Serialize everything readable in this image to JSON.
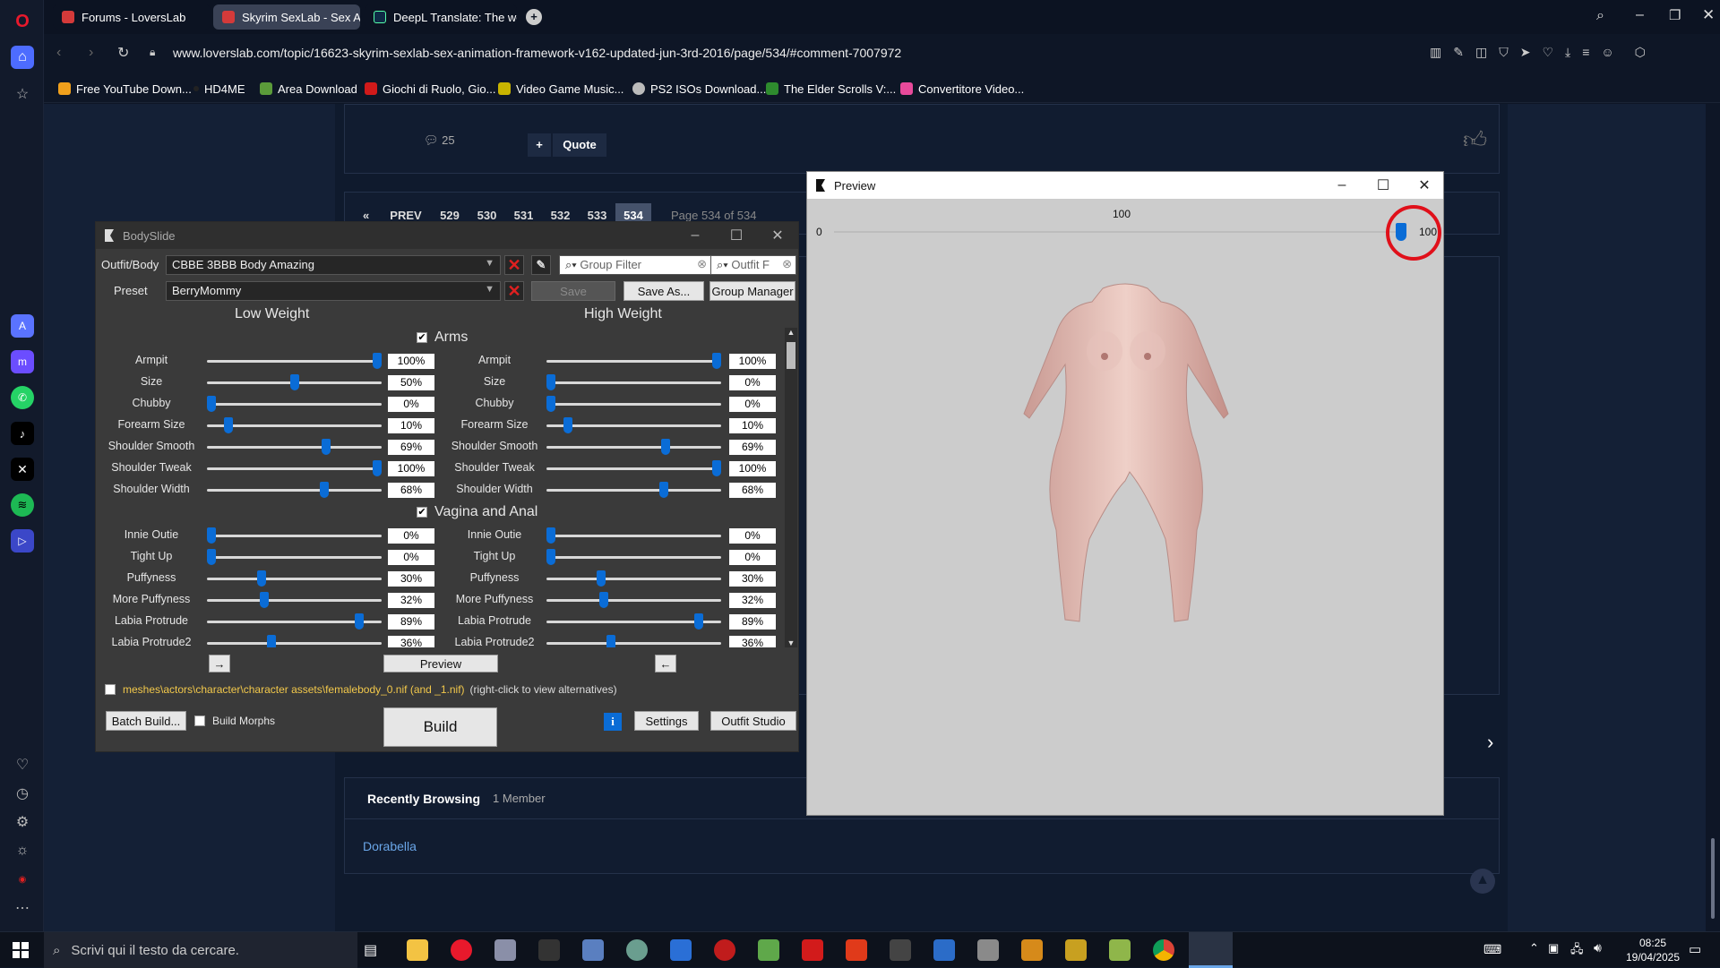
{
  "browser": {
    "tabs": [
      {
        "title": "Forums - LoversLab",
        "active": false
      },
      {
        "title": "Skyrim SexLab - Sex Anim",
        "active": true
      },
      {
        "title": "DeepL Translate: The worl",
        "active": false
      }
    ],
    "url": "www.loverslab.com/topic/16623-skyrim-sexlab-sex-animation-framework-v162-updated-jun-3rd-2016/page/534/#comment-7007972",
    "bookmarks": [
      "Free YouTube Down...",
      "HD4ME",
      "Area Download",
      "Giochi di Ruolo, Gio...",
      "Video Game Music...",
      "PS2 ISOs Download...",
      "The Elder Scrolls V:...",
      "Convertitore Video..."
    ]
  },
  "forum": {
    "comment_count": "25",
    "quote_label": "Quote",
    "add_label": "+",
    "pagination": {
      "first": "«",
      "prev": "PREV",
      "pages": [
        "529",
        "530",
        "531",
        "532",
        "533",
        "534"
      ],
      "current": "534",
      "page_of": "Page 534 of 534"
    },
    "recently_browsing": {
      "title": "Recently Browsing",
      "count": "1 Member",
      "member": "Dorabella"
    }
  },
  "bodyslide": {
    "title": "BodySlide",
    "outfit_label": "Outfit/Body",
    "outfit_value": "CBBE 3BBB Body Amazing",
    "preset_label": "Preset",
    "preset_value": "BerryMommy",
    "group_filter_placeholder": "Group Filter",
    "outfit_filter_placeholder": "Outfit F",
    "save_label": "Save",
    "save_as_label": "Save As...",
    "group_manager_label": "Group Manager",
    "low_weight_label": "Low Weight",
    "high_weight_label": "High Weight",
    "sections": [
      {
        "name": "Arms",
        "sliders": [
          {
            "label": "Armpit",
            "low": "100%",
            "high": "100%",
            "low_v": 100,
            "high_v": 100
          },
          {
            "label": "Size",
            "low": "50%",
            "high": "0%",
            "low_v": 50,
            "high_v": 0
          },
          {
            "label": "Chubby",
            "low": "0%",
            "high": "0%",
            "low_v": 0,
            "high_v": 0
          },
          {
            "label": "Forearm Size",
            "low": "10%",
            "high": "10%",
            "low_v": 10,
            "high_v": 10
          },
          {
            "label": "Shoulder Smooth",
            "low": "69%",
            "high": "69%",
            "low_v": 69,
            "high_v": 69
          },
          {
            "label": "Shoulder Tweak",
            "low": "100%",
            "high": "100%",
            "low_v": 100,
            "high_v": 100
          },
          {
            "label": "Shoulder Width",
            "low": "68%",
            "high": "68%",
            "low_v": 68,
            "high_v": 68
          }
        ]
      },
      {
        "name": "Vagina and Anal",
        "sliders": [
          {
            "label": "Innie Outie",
            "low": "0%",
            "high": "0%",
            "low_v": 0,
            "high_v": 0
          },
          {
            "label": "Tight Up",
            "low": "0%",
            "high": "0%",
            "low_v": 0,
            "high_v": 0
          },
          {
            "label": "Puffyness",
            "low": "30%",
            "high": "30%",
            "low_v": 30,
            "high_v": 30
          },
          {
            "label": "More Puffyness",
            "low": "32%",
            "high": "32%",
            "low_v": 32,
            "high_v": 32
          },
          {
            "label": "Labia Protrude",
            "low": "89%",
            "high": "89%",
            "low_v": 89,
            "high_v": 89
          },
          {
            "label": "Labia Protrude2",
            "low": "36%",
            "high": "36%",
            "low_v": 36,
            "high_v": 36
          }
        ]
      }
    ],
    "arrow_right_label": "→",
    "arrow_left_label": "←",
    "preview_label": "Preview",
    "output_path": "meshes\\actors\\character\\character assets\\femalebody_0.nif (and _1.nif)",
    "output_hint": "(right-click to view alternatives)",
    "batch_build_label": "Batch Build...",
    "build_morphs_label": "Build Morphs",
    "build_label": "Build",
    "settings_label": "Settings",
    "outfit_studio_label": "Outfit Studio"
  },
  "preview": {
    "title": "Preview",
    "weight_min": "0",
    "weight_max": "100",
    "weight_current": "100",
    "weight_value": 100
  },
  "taskbar": {
    "search_placeholder": "Scrivi qui il testo da cercare.",
    "time": "08:25",
    "date": "19/04/2025"
  },
  "colors": {
    "accent_blue": "#0a6cd6",
    "red_x": "#e02020",
    "highlight_circle": "#e0101a"
  }
}
